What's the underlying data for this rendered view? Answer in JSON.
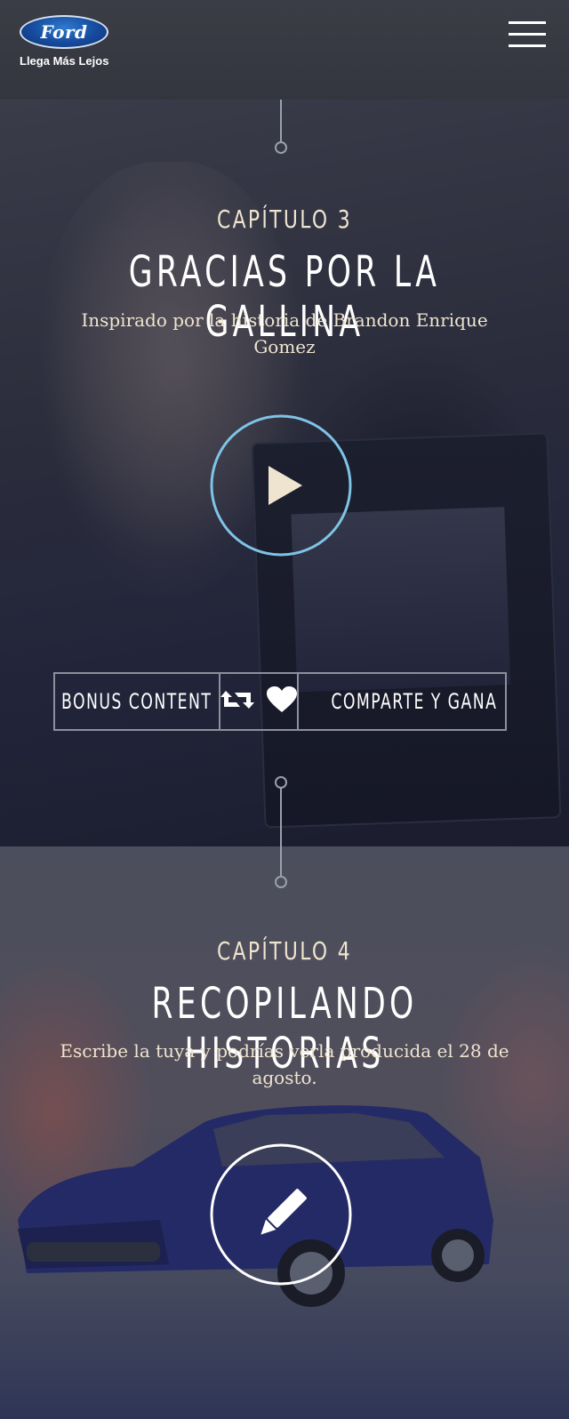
{
  "header": {
    "logo_text": "Ford",
    "tagline": "Llega Más Lejos"
  },
  "chapter3": {
    "label": "CAPÍTULO 3",
    "title": "GRACIAS POR LA GALLINA",
    "subtitle": "Inspirado por la historia de Brandon Enrique Gomez",
    "play_icon": "play-icon",
    "actions": {
      "bonus_label": "BONUS CONTENT",
      "share_label": "COMPARTE Y GANA",
      "retweet_icon": "retweet-icon",
      "like_icon": "heart-icon"
    }
  },
  "chapter4": {
    "label": "CAPÍTULO 4",
    "title": "RECOPILANDO HISTORIAS",
    "subtitle": "Escribe la tuya y podrías verla producida el 28 de agosto.",
    "edit_icon": "pencil-icon"
  },
  "colors": {
    "accent_ring": "#7ec4e6",
    "cream_text": "#efe4cf",
    "ford_blue": "#164a9c"
  }
}
